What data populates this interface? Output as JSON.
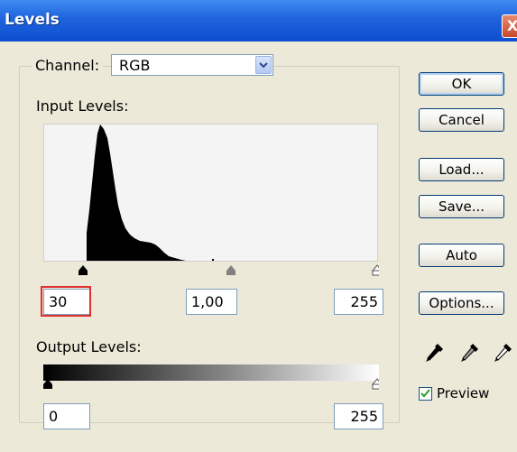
{
  "window": {
    "title": "Levels",
    "close_glyph": "X"
  },
  "channel": {
    "label": "Channel:",
    "value": "RGB"
  },
  "input_levels": {
    "label": "Input Levels:",
    "black_value": "30",
    "gamma_value": "1,00",
    "white_value": "255"
  },
  "output_levels": {
    "label": "Output Levels:",
    "black_value": "0",
    "white_value": "255"
  },
  "buttons": {
    "ok": "OK",
    "cancel": "Cancel",
    "load": "Load...",
    "save": "Save...",
    "auto": "Auto",
    "options": "Options..."
  },
  "eyedroppers": [
    "black-eyedropper-icon",
    "gray-eyedropper-icon",
    "white-eyedropper-icon"
  ],
  "preview": {
    "label": "Preview",
    "checked": true
  },
  "colors": {
    "title_bar": "#0b4fd0",
    "dialog_bg": "#ece9d8",
    "highlight": "#e03030"
  }
}
